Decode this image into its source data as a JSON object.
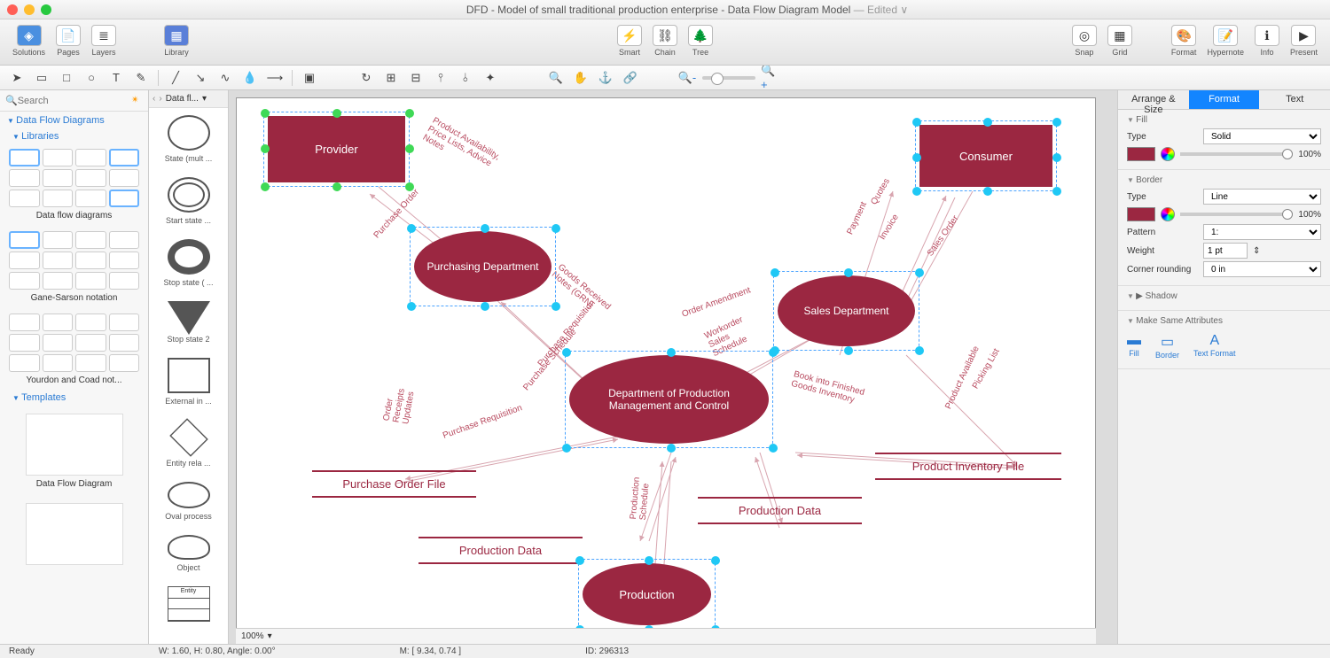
{
  "window": {
    "title": "DFD - Model of small traditional production enterprise - Data Flow Diagram Model",
    "edited": "— Edited ∨"
  },
  "toolbar": {
    "solutions": "Solutions",
    "pages": "Pages",
    "layers": "Layers",
    "library": "Library",
    "smart": "Smart",
    "chain": "Chain",
    "tree": "Tree",
    "snap": "Snap",
    "grid": "Grid",
    "format": "Format",
    "hypernote": "Hypernote",
    "info": "Info",
    "present": "Present"
  },
  "leftpanel": {
    "search_placeholder": "Search",
    "tree_root": "Data Flow Diagrams",
    "tree_libs": "Libraries",
    "lib1": "Data flow diagrams",
    "lib2": "Gane-Sarson notation",
    "lib3": "Yourdon and Coad not...",
    "tree_templates": "Templates",
    "tpl1": "Data Flow Diagram"
  },
  "shapes": {
    "breadcrumb": "Data fl...",
    "items": [
      "State (mult ...",
      "Start state ...",
      "Stop state ( ...",
      "Stop state 2",
      "External in ...",
      "Entity rela ...",
      "Oval process",
      "Object",
      "Entity"
    ]
  },
  "diagram": {
    "provider": "Provider",
    "consumer": "Consumer",
    "purchasing": "Purchasing Department",
    "sales": "Sales Department",
    "prodmgmt": "Department of Production Management and Control",
    "production": "Production",
    "ds_pof": "Purchase Order File",
    "ds_pd1": "Production Data",
    "ds_pd2": "Production Data",
    "ds_pif": "Product Inventory File",
    "flows": {
      "availability": "Product Availability, Price Lists, Advice Notes",
      "po": "Purchase Order",
      "grn": "Goods Received Notes (GRN)",
      "preq": "Purchase Requisition",
      "psched": "Purchase Schedule",
      "preq2": "Purchase Requisition",
      "oru": "Order Receipts Updates",
      "ordamend": "Order Amendment",
      "wos": "Workorder Sales Schedule",
      "prodsched": "Production Schedule",
      "bookinv": "Book into Finished Goods Inventory",
      "prodavail": "Product Available",
      "picklist": "Picking List",
      "payment": "Payment",
      "invoice": "Invoice",
      "salesorder": "Sales Order",
      "quotes": "Quotes"
    }
  },
  "rightpanel": {
    "tabs": {
      "arrange": "Arrange & Size",
      "format": "Format",
      "text": "Text"
    },
    "fill": {
      "hdr": "Fill",
      "type_lbl": "Type",
      "type_val": "Solid",
      "pct": "100%"
    },
    "border": {
      "hdr": "Border",
      "type_lbl": "Type",
      "type_val": "Line",
      "pct": "100%",
      "pattern_lbl": "Pattern",
      "pattern_val": "1:",
      "weight_lbl": "Weight",
      "weight_val": "1 pt",
      "corner_lbl": "Corner rounding",
      "corner_val": "0 in"
    },
    "shadow": {
      "hdr": "Shadow"
    },
    "sameattr": {
      "hdr": "Make Same Attributes",
      "fill": "Fill",
      "border": "Border",
      "textfmt": "Text Format"
    }
  },
  "zoom": "100%",
  "status": {
    "ready": "Ready",
    "wh": "W: 1.60,  H: 0.80,  Angle: 0.00°",
    "m": "M: [ 9.34, 0.74 ]",
    "id": "ID: 296313"
  }
}
